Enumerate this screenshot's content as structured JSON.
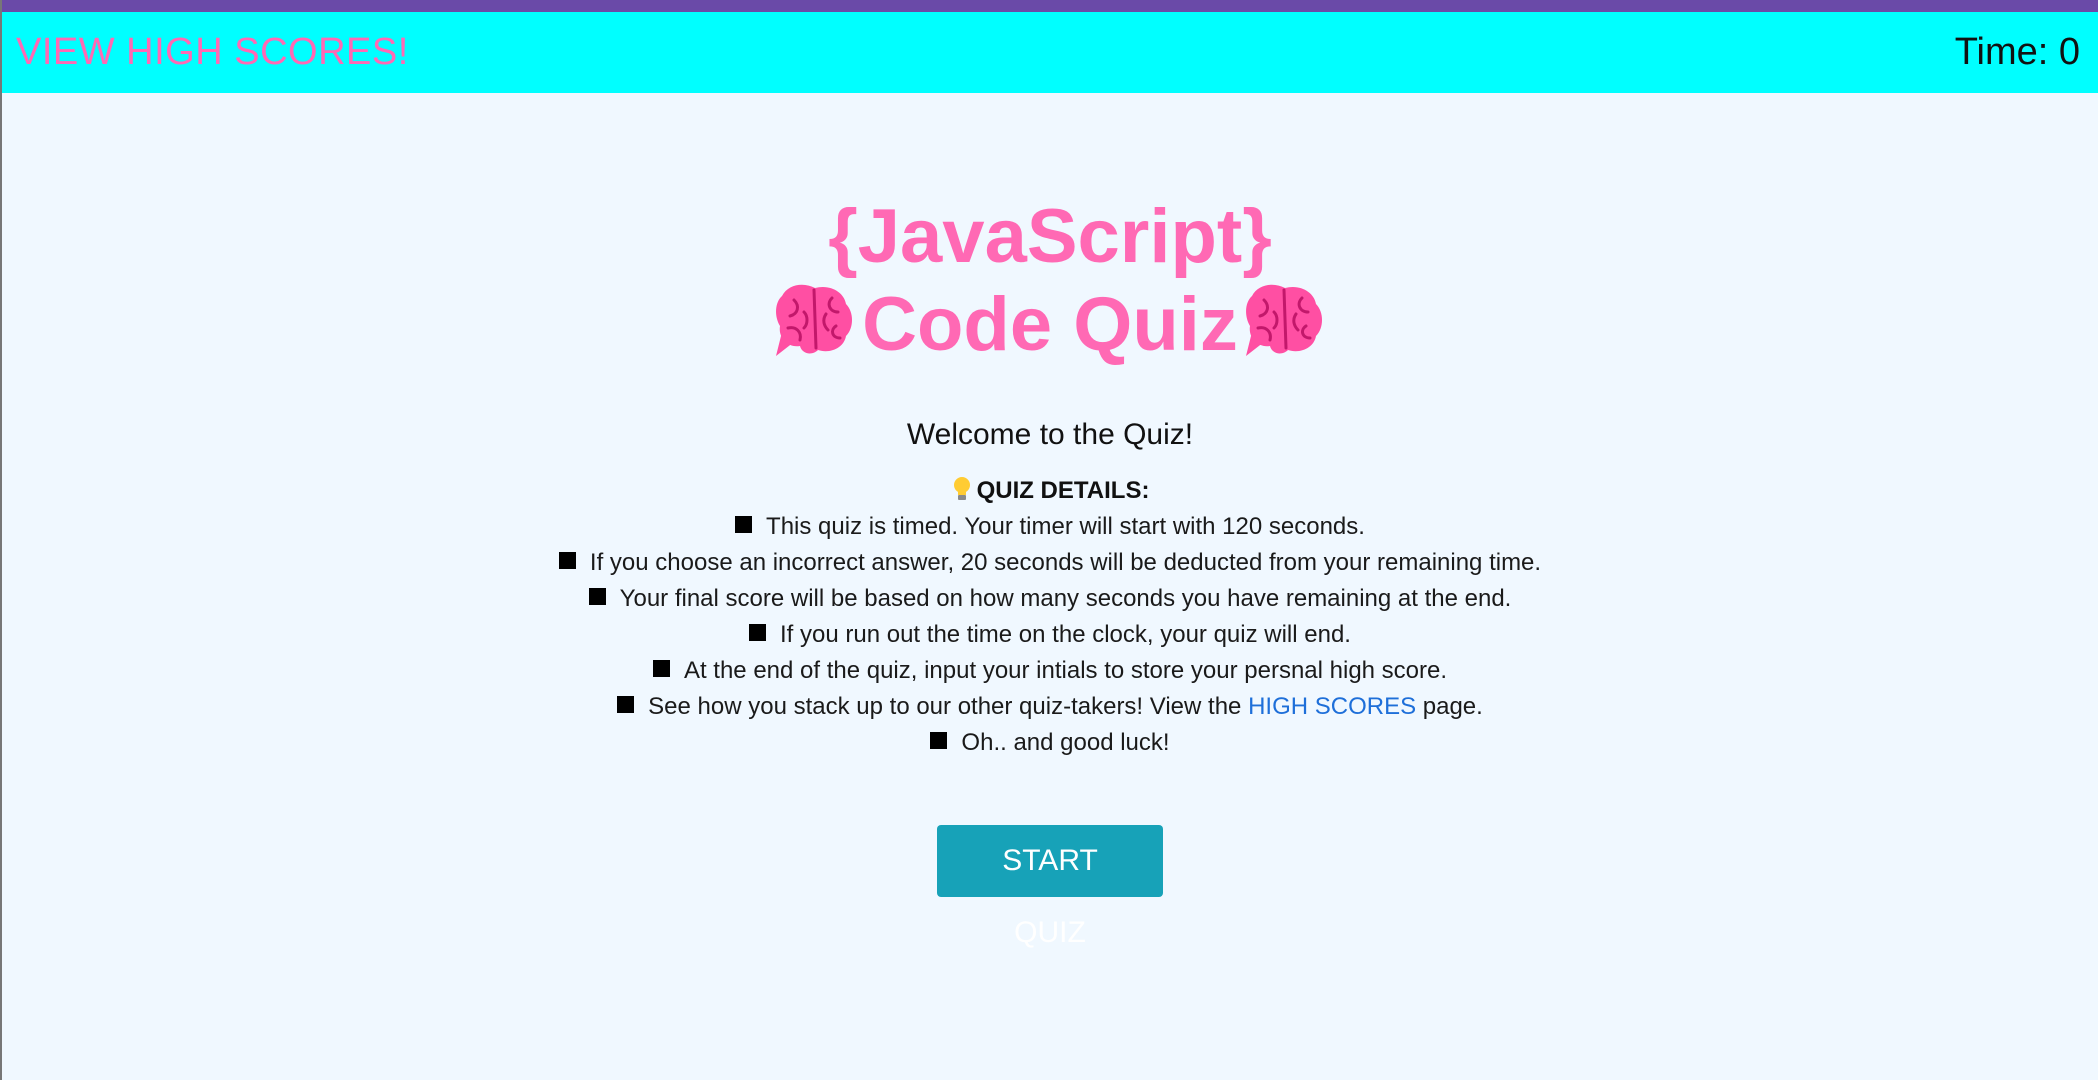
{
  "nav": {
    "high_scores_link": "VIEW HIGH SCORES!",
    "timer_label": "Time: 0"
  },
  "title": {
    "line1": "{JavaScript}",
    "line2": "Code Quiz",
    "icon": "brain-icon"
  },
  "welcome": "Welcome to the Quiz!",
  "details": {
    "heading": "QUIZ DETAILS:",
    "heading_icon": "light-bulb-icon",
    "bullet_icon": "black-square-icon",
    "items": [
      "This quiz is timed. Your timer will start with 120 seconds.",
      "If you choose an incorrect answer, 20 seconds will be deducted from your remaining time.",
      "Your final score will be based on how many seconds you have remaining at the end.",
      "If you run out the time on the clock, your quiz will end.",
      "At the end of the quiz, input your intials to store your persnal high score."
    ],
    "high_scores_item": {
      "before": "See how you stack up to our other quiz-takers! View the",
      "link": "HIGH SCORES",
      "after": "page."
    },
    "last_item": "Oh.. and good luck!"
  },
  "start_button": "START QUIZ",
  "colors": {
    "top_stripe": "#6a4aa8",
    "navbar": "#00ffff",
    "accent_pink": "#ff69b4",
    "background": "#f0f8ff",
    "button": "#17a2b8",
    "link_blue": "#1e6fd9"
  }
}
